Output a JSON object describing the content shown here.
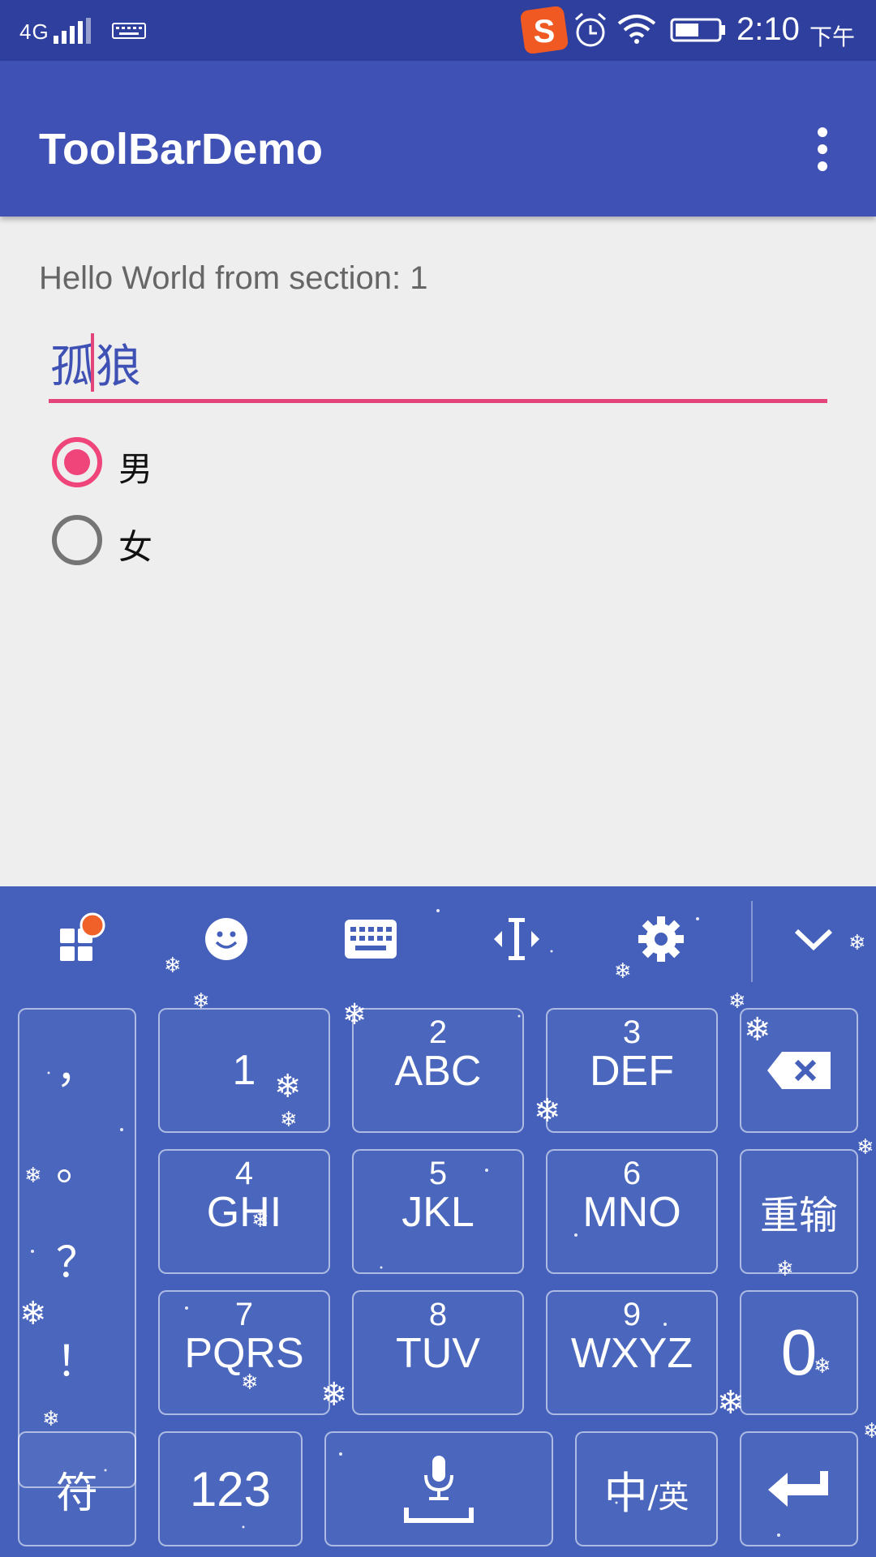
{
  "status_bar": {
    "network": "4G",
    "time": "2:10",
    "ampm": "下午"
  },
  "toolbar": {
    "title": "ToolBarDemo"
  },
  "content": {
    "section_label": "Hello World from section: 1",
    "edit_value": "孤狼",
    "radios": [
      {
        "label": "男",
        "checked": true
      },
      {
        "label": "女",
        "checked": false
      }
    ]
  },
  "colors": {
    "primary": "#3f51b5",
    "primary_dark": "#2f3f9e",
    "accent": "#f0457a",
    "keyboard_bg": "#4460bb"
  },
  "keyboard": {
    "toolbar_icons": [
      "apps-icon",
      "emoji-icon",
      "keyboard-icon",
      "cursor-move-icon",
      "settings-icon",
      "collapse-chevron-icon"
    ],
    "punct_keys": [
      "，",
      "。",
      "？",
      "！"
    ],
    "keys": {
      "k1": {
        "num": "1"
      },
      "k2": {
        "num": "2",
        "letters": "ABC"
      },
      "k3": {
        "num": "3",
        "letters": "DEF"
      },
      "k4": {
        "num": "4",
        "letters": "GHI"
      },
      "k5": {
        "num": "5",
        "letters": "JKL"
      },
      "k6": {
        "num": "6",
        "letters": "MNO"
      },
      "k7": {
        "num": "7",
        "letters": "PQRS"
      },
      "k8": {
        "num": "8",
        "letters": "TUV"
      },
      "k9": {
        "num": "9",
        "letters": "WXYZ"
      },
      "k0": {
        "num": "0"
      },
      "reset": "重输",
      "symbols": "符",
      "numbers": "123",
      "lang_main": "中",
      "lang_alt": "/英"
    }
  }
}
